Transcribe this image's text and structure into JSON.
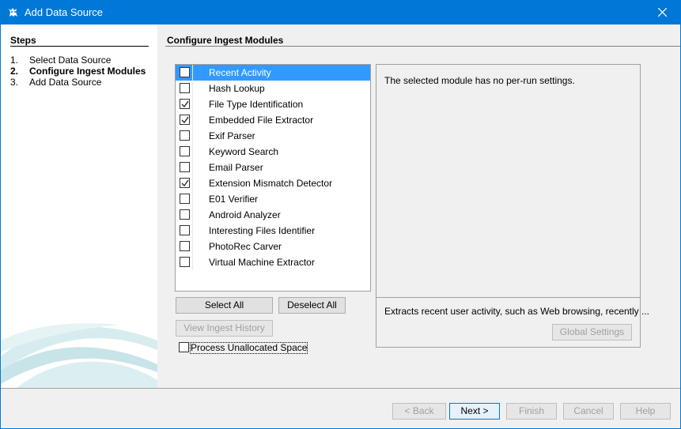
{
  "window": {
    "title": "Add Data Source"
  },
  "steps": {
    "heading": "Steps",
    "items": [
      {
        "num": "1.",
        "label": "Select Data Source",
        "current": false
      },
      {
        "num": "2.",
        "label": "Configure Ingest Modules",
        "current": true
      },
      {
        "num": "3.",
        "label": "Add Data Source",
        "current": false
      }
    ]
  },
  "content": {
    "heading": "Configure Ingest Modules"
  },
  "modules": [
    {
      "name": "Recent Activity",
      "checked": false,
      "selected": true
    },
    {
      "name": "Hash Lookup",
      "checked": false,
      "selected": false
    },
    {
      "name": "File Type Identification",
      "checked": true,
      "selected": false
    },
    {
      "name": "Embedded File Extractor",
      "checked": true,
      "selected": false
    },
    {
      "name": "Exif Parser",
      "checked": false,
      "selected": false
    },
    {
      "name": "Keyword Search",
      "checked": false,
      "selected": false
    },
    {
      "name": "Email Parser",
      "checked": false,
      "selected": false
    },
    {
      "name": "Extension Mismatch Detector",
      "checked": true,
      "selected": false
    },
    {
      "name": "E01 Verifier",
      "checked": false,
      "selected": false
    },
    {
      "name": "Android Analyzer",
      "checked": false,
      "selected": false
    },
    {
      "name": "Interesting Files Identifier",
      "checked": false,
      "selected": false
    },
    {
      "name": "PhotoRec Carver",
      "checked": false,
      "selected": false
    },
    {
      "name": "Virtual Machine Extractor",
      "checked": false,
      "selected": false
    }
  ],
  "buttons": {
    "select_all": "Select All",
    "deselect_all": "Deselect All",
    "view_history": "View Ingest History",
    "global_settings": "Global Settings",
    "back": "< Back",
    "next": "Next >",
    "finish": "Finish",
    "cancel": "Cancel",
    "help": "Help"
  },
  "settings": {
    "message": "The selected module has no per-run settings.",
    "description": "Extracts recent user activity, such as Web browsing, recently ..."
  },
  "options": {
    "process_unallocated": {
      "label": "Process Unallocated Space",
      "checked": false
    }
  },
  "colors": {
    "titlebar": "#0078d7",
    "selection": "#3399ff"
  }
}
